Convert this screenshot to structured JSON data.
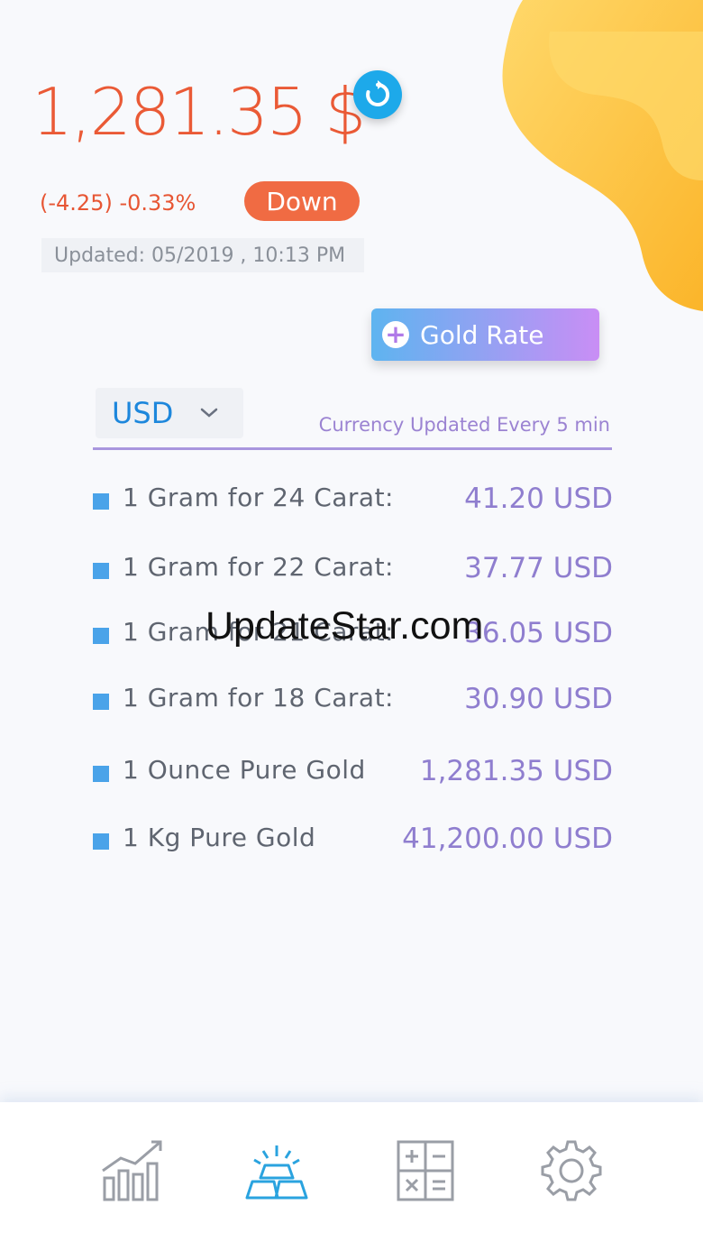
{
  "price": "1,281.35 $",
  "change": "(-4.25) -0.33%",
  "trend_badge": "Down",
  "updated": "Updated: 05/2019 , 10:13 PM",
  "gold_rate_button": "Gold Rate",
  "currency": {
    "selected": "USD",
    "note": "Currency Updated Every 5 min"
  },
  "rates": [
    {
      "label": "1 Gram for 24 Carat:",
      "value": "41.20 USD"
    },
    {
      "label": "1 Gram for 22 Carat:",
      "value": "37.77 USD"
    },
    {
      "label": "1 Gram for 21 Carat:",
      "value": "36.05 USD"
    },
    {
      "label": "1 Gram for 18 Carat:",
      "value": "30.90 USD"
    },
    {
      "label": "1 Ounce Pure Gold",
      "value": "1,281.35 USD"
    },
    {
      "label": "1 Kg Pure Gold",
      "value": "41,200.00 USD"
    }
  ],
  "watermark": "UpdateStar.com",
  "tabs": [
    {
      "icon": "chart-icon",
      "active": false
    },
    {
      "icon": "gold-bars-icon",
      "active": true
    },
    {
      "icon": "calculator-icon",
      "active": false
    },
    {
      "icon": "gear-icon",
      "active": false
    }
  ],
  "colors": {
    "price": "#ea5a36",
    "badge": "#f06b43",
    "accent_blue": "#1da9ea",
    "value_purple": "#8f7ecf"
  }
}
